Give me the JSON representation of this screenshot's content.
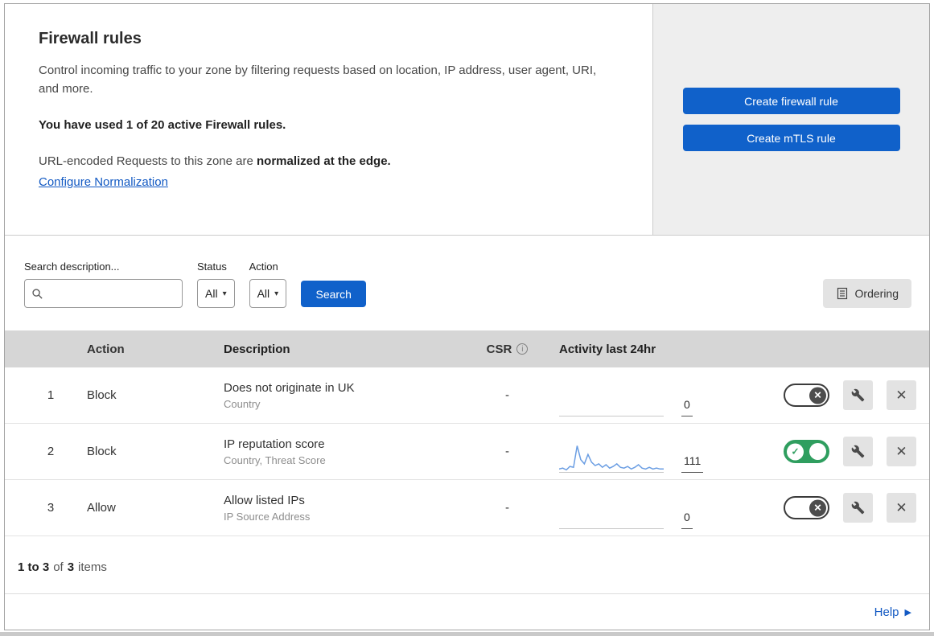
{
  "header": {
    "title": "Firewall rules",
    "description": "Control incoming traffic to your zone by filtering requests based on location, IP address, user agent, URI, and more.",
    "usage": "You have used 1 of 20 active Firewall rules.",
    "normalization_prefix": "URL-encoded Requests to this zone are ",
    "normalization_bold": "normalized at the edge.",
    "normalization_link": "Configure Normalization",
    "buttons": {
      "create_firewall": "Create firewall rule",
      "create_mtls": "Create mTLS rule"
    }
  },
  "filters": {
    "search_label": "Search description...",
    "status_label": "Status",
    "status_value": "All",
    "action_label": "Action",
    "action_value": "All",
    "search_button": "Search",
    "ordering_button": "Ordering"
  },
  "table": {
    "headers": {
      "action": "Action",
      "description": "Description",
      "csr": "CSR",
      "activity": "Activity last 24hr"
    },
    "rows": [
      {
        "priority": "1",
        "action": "Block",
        "description": "Does not originate in UK",
        "description_sub": "Country",
        "csr": "-",
        "activity_count": "0",
        "enabled": false,
        "activity_series": []
      },
      {
        "priority": "2",
        "action": "Block",
        "description": "IP reputation score",
        "description_sub": "Country, Threat Score",
        "csr": "-",
        "activity_count": "111",
        "enabled": true,
        "activity_series": [
          3,
          4,
          2,
          6,
          5,
          30,
          14,
          9,
          20,
          11,
          7,
          9,
          5,
          8,
          4,
          6,
          9,
          5,
          4,
          6,
          3,
          5,
          8,
          4,
          3,
          5,
          3,
          4,
          3,
          3
        ]
      },
      {
        "priority": "3",
        "action": "Allow",
        "description": "Allow listed IPs",
        "description_sub": "IP Source Address",
        "csr": "-",
        "activity_count": "0",
        "enabled": false,
        "activity_series": []
      }
    ]
  },
  "footer": {
    "range": "1 to 3",
    "of": "of",
    "total": "3",
    "items": "items"
  },
  "help": {
    "label": "Help"
  },
  "colors": {
    "primary_blue": "#1061ca",
    "toggle_on_green": "#2f9e5f",
    "link_blue": "#1259c3",
    "sparkline_blue": "#6b9ee3",
    "panel_gray": "#eeeeee",
    "table_header_gray": "#d6d6d6"
  }
}
